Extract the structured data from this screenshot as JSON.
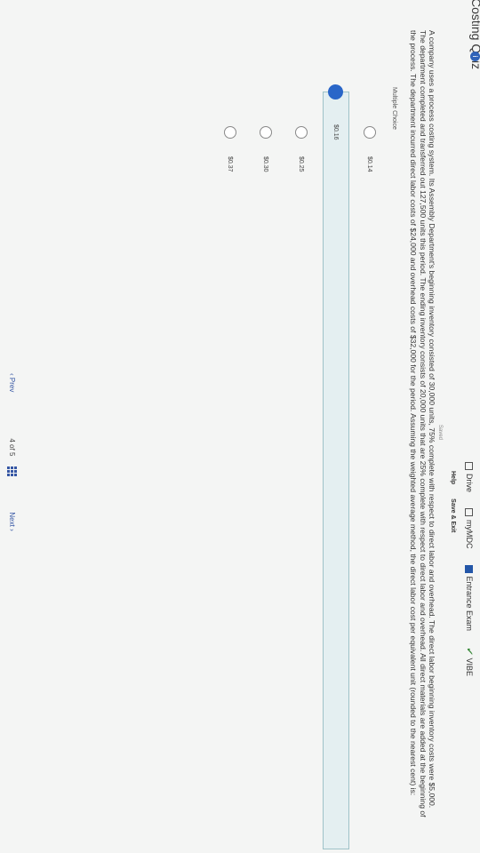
{
  "bookmarks": [
    {
      "label": "Drive",
      "icon": "drive-icon"
    },
    {
      "label": "myMDC",
      "icon": "page-icon"
    },
    {
      "label": "Entrance Exam",
      "icon": "bookmark-icon"
    },
    {
      "label": "VIBE",
      "icon": "check-icon"
    }
  ],
  "header": {
    "quiz_title": "Costing Quiz",
    "info_badge": "i",
    "help_label": "Help",
    "save_exit_label": "Save & Exit",
    "saved_label": "Saved"
  },
  "question": {
    "text": "A company uses a process costing system. Its Assembly Department's beginning inventory consisted of 30,000 units, 75% complete with respect to direct labor and overhead. The direct labor beginning inventory costs were $5,000. The department completed and transferred out 127,500 units this period. The ending inventory consists of 20,000 units that are 25% complete with respect to direct labor and overhead. All direct materials are added at the beginning of the process. The department incurred direct labor costs of $24,000 and overhead costs of $32,000 for the period. Assuming the weighted average method, the direct labor cost per equivalent unit (rounded to the nearest cent) is:"
  },
  "mc_label": "Multiple Choice",
  "choices": [
    {
      "label": "$0.14",
      "selected": false
    },
    {
      "label": "$0.16",
      "selected": true
    },
    {
      "label": "$0.25",
      "selected": false
    },
    {
      "label": "$0.30",
      "selected": false
    },
    {
      "label": "$0.37",
      "selected": false
    }
  ],
  "footer": {
    "prev_label": "Prev",
    "page_current": "4",
    "page_of": "of",
    "page_total": "5",
    "next_label": "Next"
  },
  "colors": {
    "accent": "#2a66c8",
    "selected_bg": "#e4eff1"
  }
}
